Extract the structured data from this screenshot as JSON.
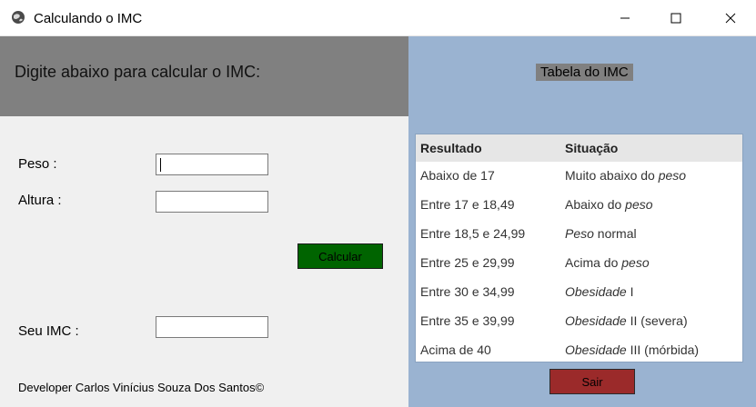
{
  "window": {
    "title": "Calculando o IMC",
    "icon": "globe-icon",
    "controls": [
      "minimize",
      "maximize",
      "close"
    ]
  },
  "form": {
    "header": "Digite abaixo para calcular o IMC:",
    "peso_label": "Peso :",
    "peso_value": "",
    "altura_label": "Altura :",
    "altura_value": "",
    "calcular_label": "Calcular",
    "imc_label": "Seu IMC :",
    "imc_value": "",
    "developer": "Developer Carlos Vinícius Souza Dos Santos©"
  },
  "tabela": {
    "title": "Tabela do IMC",
    "headers": [
      "Resultado",
      "Situação"
    ],
    "rows": [
      {
        "resultado": "Abaixo de 17",
        "situacao": [
          "Muito abaixo do ",
          "peso",
          ""
        ]
      },
      {
        "resultado": "Entre 17 e 18,49",
        "situacao": [
          "Abaixo do ",
          "peso",
          ""
        ]
      },
      {
        "resultado": "Entre 18,5 e 24,99",
        "situacao": [
          "",
          "Peso",
          " normal"
        ]
      },
      {
        "resultado": "Entre 25 e 29,99",
        "situacao": [
          "Acima do ",
          "peso",
          ""
        ]
      },
      {
        "resultado": "Entre 30 e 34,99",
        "situacao": [
          "",
          "Obesidade",
          " I"
        ]
      },
      {
        "resultado": "Entre 35 e 39,99",
        "situacao": [
          "",
          "Obesidade",
          " II (severa)"
        ]
      },
      {
        "resultado": "Acima de 40",
        "situacao": [
          "",
          "Obesidade",
          " III (mórbida)"
        ]
      }
    ],
    "sair_label": "Sair"
  },
  "colors": {
    "header_gray": "#808080",
    "right_panel": "#9ab3d1",
    "calcular_green": "#006400",
    "sair_red": "#9b2a2a"
  }
}
